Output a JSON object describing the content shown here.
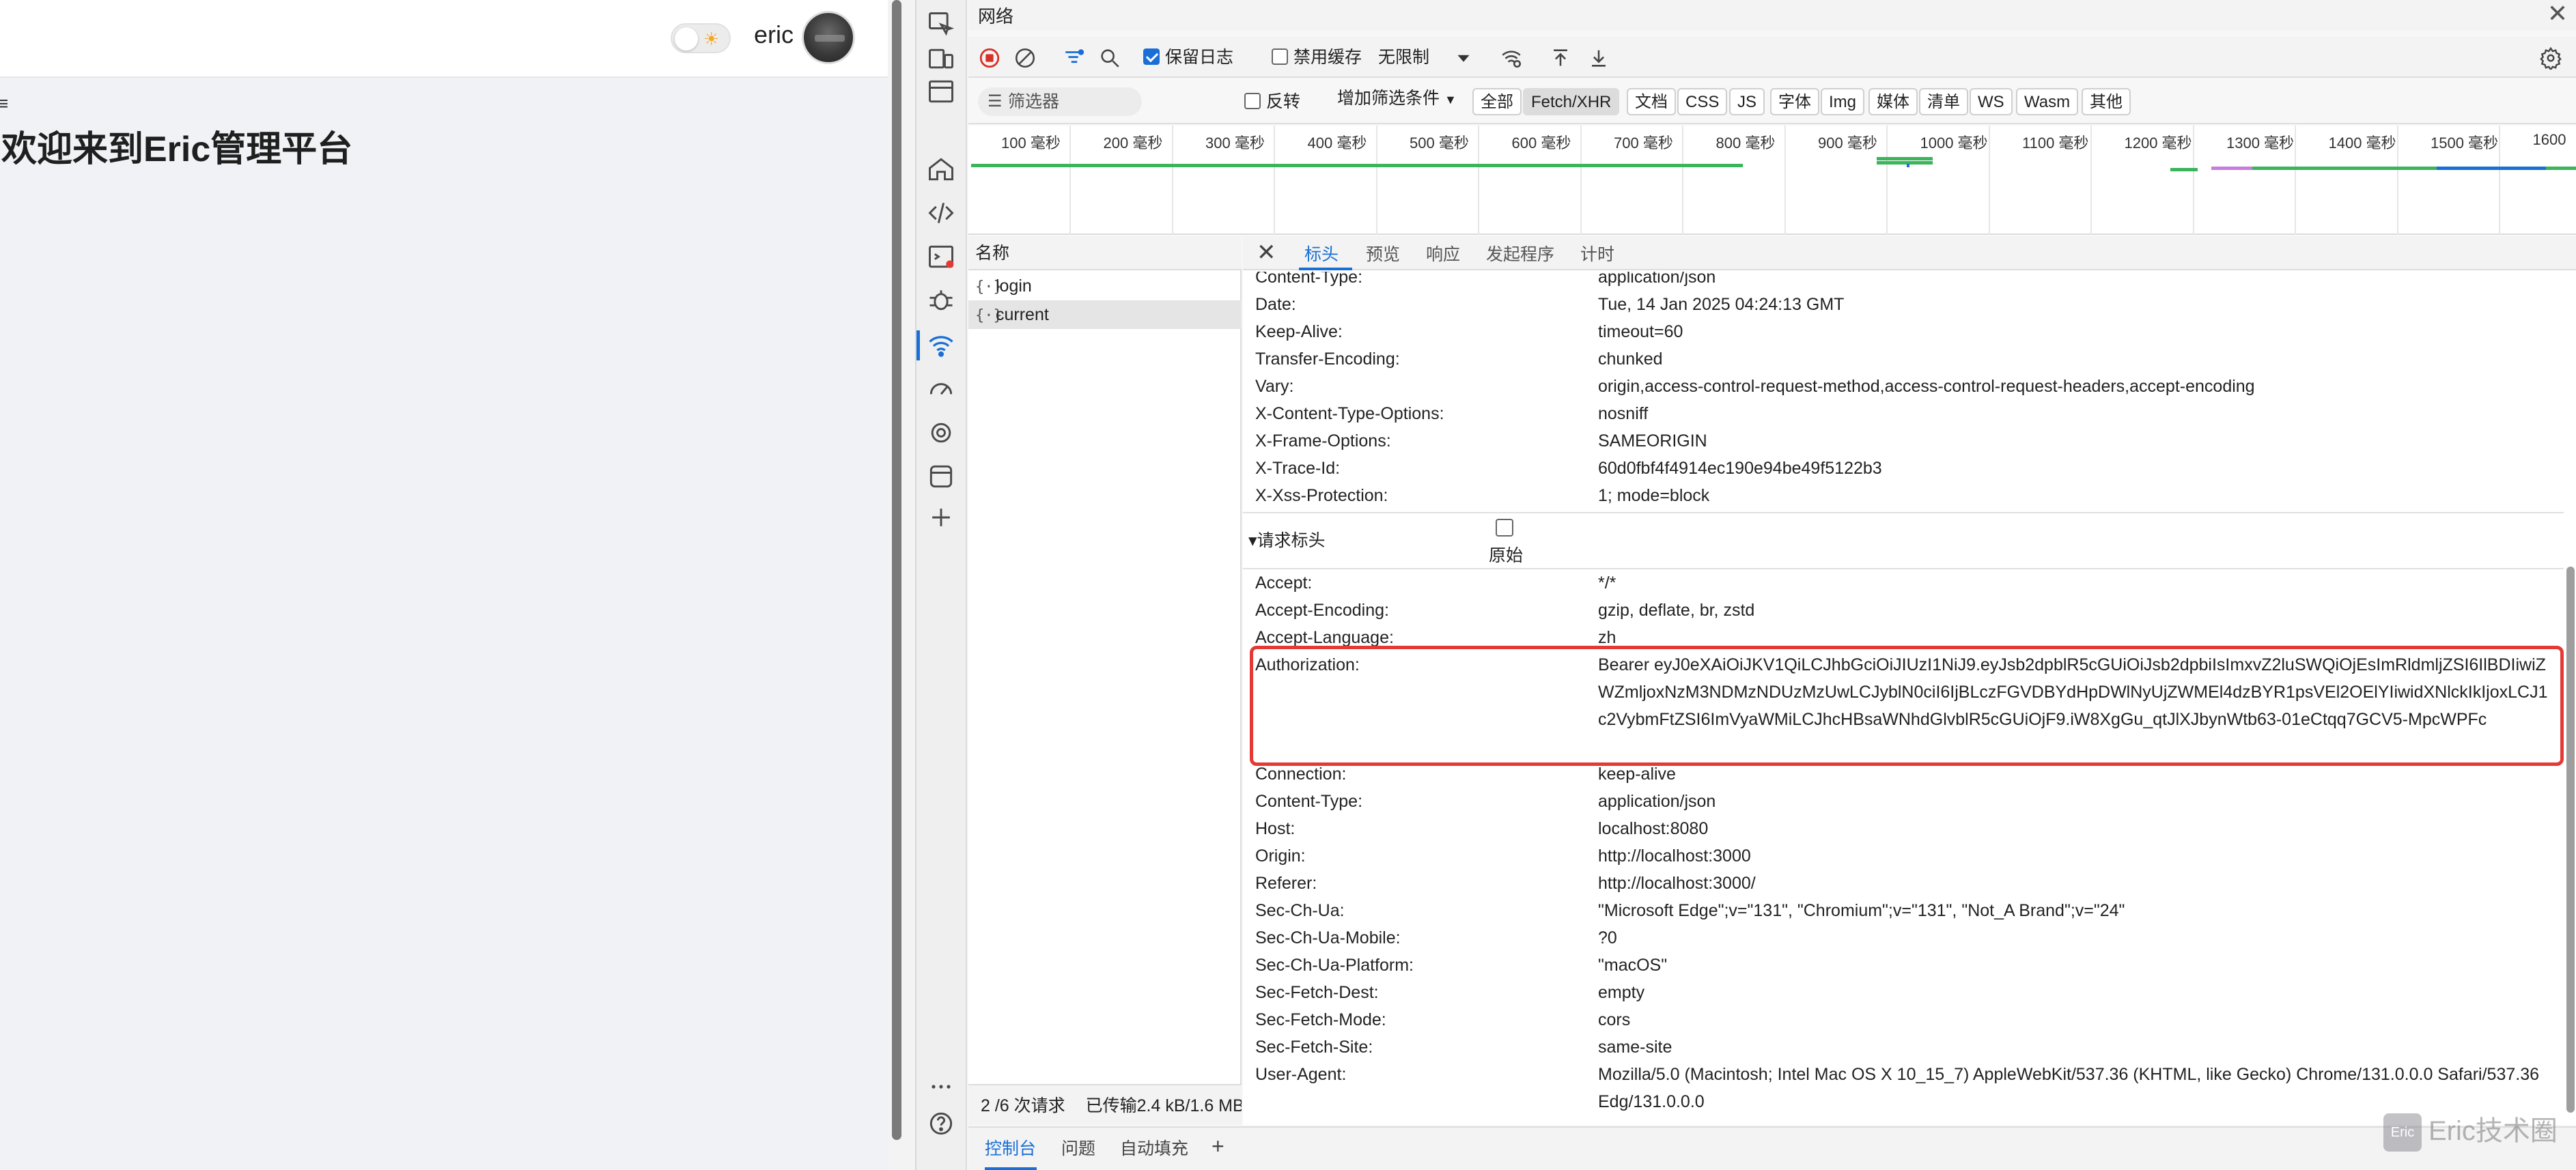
{
  "app": {
    "username": "eric",
    "welcome": "欢迎来到Eric管理平台"
  },
  "devtools": {
    "title": "网络",
    "toolbar": {
      "preserve_log": "保留日志",
      "disable_cache": "禁用缓存",
      "throttle": "无限制"
    },
    "filter": {
      "placeholder": "筛选器",
      "invert": "反转",
      "more_filters": "增加筛选条件",
      "types": [
        "全部",
        "Fetch/XHR",
        "文档",
        "CSS",
        "JS",
        "字体",
        "Img",
        "媒体",
        "清单",
        "WS",
        "Wasm",
        "其他"
      ],
      "active_type": "Fetch/XHR"
    },
    "timeline": {
      "ticks": [
        "100  毫秒",
        "200  毫秒",
        "300  毫秒",
        "400  毫秒",
        "500  毫秒",
        "600  毫秒",
        "700  毫秒",
        "800  毫秒",
        "900  毫秒",
        "1000  毫秒",
        "1100  毫秒",
        "1200  毫秒",
        "1300  毫秒",
        "1400  毫秒",
        "1500  毫秒",
        "1600"
      ]
    },
    "requests": {
      "header": "名称",
      "items": [
        {
          "name": "login",
          "selected": false
        },
        {
          "name": "current",
          "selected": true
        }
      ]
    },
    "detail_tabs": [
      "标头",
      "预览",
      "响应",
      "发起程序",
      "计时"
    ],
    "response_headers": [
      {
        "key": "Content-Type:",
        "value": "application/json"
      },
      {
        "key": "Date:",
        "value": "Tue, 14 Jan 2025 04:24:13 GMT"
      },
      {
        "key": "Keep-Alive:",
        "value": "timeout=60"
      },
      {
        "key": "Transfer-Encoding:",
        "value": "chunked"
      },
      {
        "key": "Vary:",
        "value": "origin,access-control-request-method,access-control-request-headers,accept-encoding"
      },
      {
        "key": "X-Content-Type-Options:",
        "value": "nosniff"
      },
      {
        "key": "X-Frame-Options:",
        "value": "SAMEORIGIN"
      },
      {
        "key": "X-Trace-Id:",
        "value": "60d0fbf4f4914ec190e94be49f5122b3"
      },
      {
        "key": "X-Xss-Protection:",
        "value": "1; mode=block"
      }
    ],
    "request_section": {
      "title": "▾请求标头",
      "raw_label": "原始"
    },
    "request_headers": [
      {
        "key": "Accept:",
        "value": "*/*"
      },
      {
        "key": "Accept-Encoding:",
        "value": "gzip, deflate, br, zstd"
      },
      {
        "key": "Accept-Language:",
        "value": "zh"
      },
      {
        "key": "Authorization:",
        "value": "Bearer eyJ0eXAiOiJKV1QiLCJhbGciOiJIUzI1NiJ9.eyJsb2dpblR5cGUiOiJsb2dpbiIsImxvZ2luSWQiOjEsImRldmljZSI6IlBDIiwiZWZmljoxNzM3NDMzNDUzMzUwLCJyblN0ciI6IjBLczFGVDBYdHpDWlNyUjZWMEl4dzBYR1psVEl2OElYIiwidXNlckIkIjoxLCJ1c2VybmFtZSI6ImVyaWMiLCJhcHBsaWNhdGlvblR5cGUiOjF9.iW8XgGu_qtJlXJbynWtb63-01eCtqq7GCV5-MpcWPFc"
      },
      {
        "key": "Connection:",
        "value": "keep-alive"
      },
      {
        "key": "Content-Type:",
        "value": "application/json"
      },
      {
        "key": "Host:",
        "value": "localhost:8080"
      },
      {
        "key": "Origin:",
        "value": "http://localhost:3000"
      },
      {
        "key": "Referer:",
        "value": "http://localhost:3000/"
      },
      {
        "key": "Sec-Ch-Ua:",
        "value": "\"Microsoft Edge\";v=\"131\", \"Chromium\";v=\"131\", \"Not_A Brand\";v=\"24\""
      },
      {
        "key": "Sec-Ch-Ua-Mobile:",
        "value": "?0"
      },
      {
        "key": "Sec-Ch-Ua-Platform:",
        "value": "\"macOS\""
      },
      {
        "key": "Sec-Fetch-Dest:",
        "value": "empty"
      },
      {
        "key": "Sec-Fetch-Mode:",
        "value": "cors"
      },
      {
        "key": "Sec-Fetch-Site:",
        "value": "same-site"
      },
      {
        "key": "User-Agent:",
        "value": "Mozilla/5.0 (Macintosh; Intel Mac OS X 10_15_7) AppleWebKit/537.36 (KHTML, like Gecko) Chrome/131.0.0.0 Safari/537.36 Edg/131.0.0.0"
      }
    ],
    "status": {
      "requests": "2 /6 次请求",
      "transferred": "已传输2.4 kB/1.6 MB"
    },
    "drawer_tabs": [
      "控制台",
      "问题",
      "自动填充"
    ],
    "colors": {
      "accent": "#1a6fd6",
      "highlight": "#e53935"
    }
  },
  "watermark": {
    "logo": "Eric",
    "text": "Eric技术圈"
  }
}
